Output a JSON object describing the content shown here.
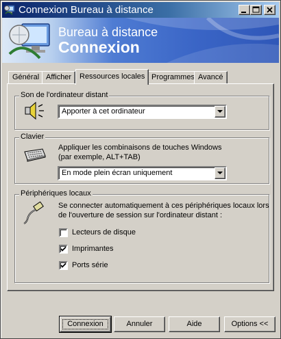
{
  "window": {
    "title": "Connexion Bureau à distance",
    "controls": [
      "minimize",
      "maximize",
      "close"
    ]
  },
  "banner": {
    "line1": "Bureau à distance",
    "line2": "Connexion"
  },
  "tabs": [
    {
      "label": "Général",
      "active": false
    },
    {
      "label": "Afficher",
      "active": false
    },
    {
      "label": "Ressources locales",
      "active": true
    },
    {
      "label": "Programmes",
      "active": false
    },
    {
      "label": "Avancé",
      "active": false
    }
  ],
  "groups": {
    "sound": {
      "legend": "Son de l'ordinateur distant",
      "icon": "speaker-icon",
      "select_value": "Apporter à cet ordinateur"
    },
    "keyboard": {
      "legend": "Clavier",
      "icon": "keyboard-icon",
      "description_line1": "Appliquer les combinaisons de touches Windows",
      "description_line2": "(par exemple, ALT+TAB)",
      "select_value": "En mode plein écran uniquement"
    },
    "devices": {
      "legend": "Périphériques locaux",
      "icon": "plug-icon",
      "description_line1": "Se connecter automatiquement à ces périphériques locaux lors",
      "description_line2": "de l'ouverture de session sur l'ordinateur distant :",
      "options": [
        {
          "label": "Lecteurs de disque",
          "checked": false
        },
        {
          "label": "Imprimantes",
          "checked": true
        },
        {
          "label": "Ports série",
          "checked": true
        }
      ]
    }
  },
  "buttons": {
    "connect": "Connexion",
    "cancel": "Annuler",
    "help": "Aide",
    "options": "Options <<"
  },
  "colors": {
    "face": "#d4d0c8",
    "title_gradient_start": "#0a246a",
    "title_gradient_end": "#a6caf0"
  }
}
